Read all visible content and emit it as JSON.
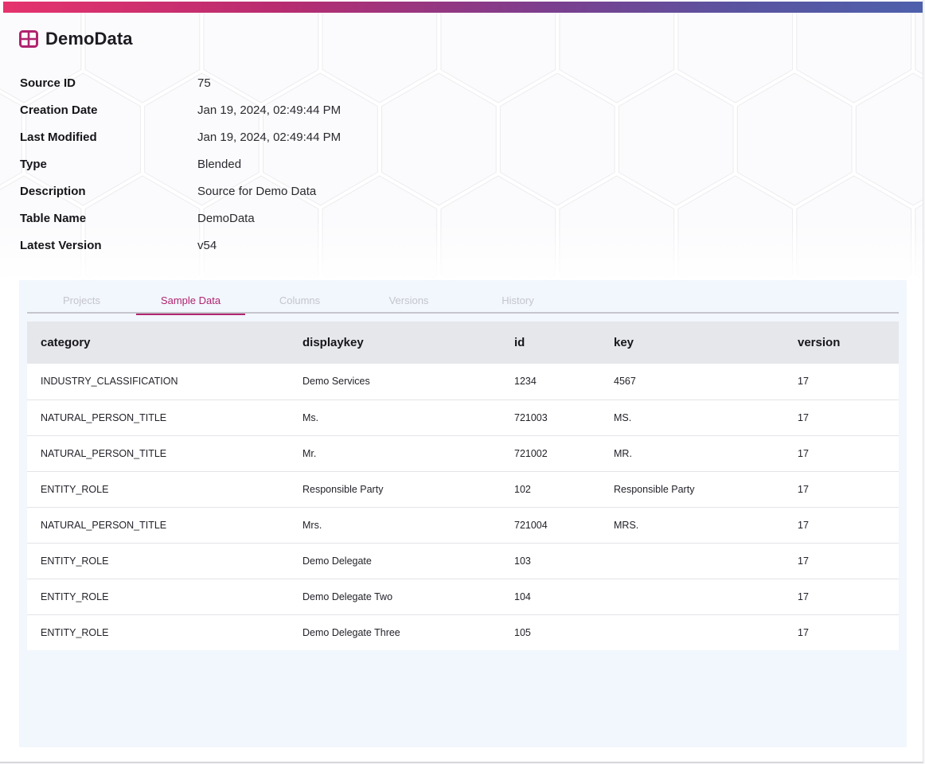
{
  "header": {
    "icon": "table-grid-icon",
    "title": "DemoData"
  },
  "colors": {
    "accent": "#b0246f",
    "gradient_start": "#e5336d",
    "gradient_end": "#4e60ac",
    "panel_bg": "#f2f6fd"
  },
  "metadata": [
    {
      "label": "Source ID",
      "value": "75"
    },
    {
      "label": "Creation Date",
      "value": "Jan 19, 2024, 02:49:44 PM"
    },
    {
      "label": "Last Modified",
      "value": "Jan 19, 2024, 02:49:44 PM"
    },
    {
      "label": "Type",
      "value": "Blended"
    },
    {
      "label": "Description",
      "value": "Source for Demo Data"
    },
    {
      "label": "Table Name",
      "value": "DemoData"
    },
    {
      "label": "Latest Version",
      "value": "v54"
    }
  ],
  "tabs": [
    {
      "label": "Projects",
      "active": false
    },
    {
      "label": "Sample Data",
      "active": true
    },
    {
      "label": "Columns",
      "active": false
    },
    {
      "label": "Versions",
      "active": false
    },
    {
      "label": "History",
      "active": false
    }
  ],
  "table": {
    "columns": [
      "category",
      "displaykey",
      "id",
      "key",
      "version"
    ],
    "rows": [
      [
        "INDUSTRY_CLASSIFICATION",
        "Demo Services",
        "1234",
        "4567",
        "17"
      ],
      [
        "NATURAL_PERSON_TITLE",
        "Ms.",
        "721003",
        "MS.",
        "17"
      ],
      [
        "NATURAL_PERSON_TITLE",
        "Mr.",
        "721002",
        "MR.",
        "17"
      ],
      [
        "ENTITY_ROLE",
        "Responsible Party",
        "102",
        "Responsible Party",
        "17"
      ],
      [
        "NATURAL_PERSON_TITLE",
        "Mrs.",
        "721004",
        "MRS.",
        "17"
      ],
      [
        "ENTITY_ROLE",
        "Demo Delegate",
        "103",
        "",
        "17"
      ],
      [
        "ENTITY_ROLE",
        "Demo Delegate Two",
        "104",
        "",
        "17"
      ],
      [
        "ENTITY_ROLE",
        "Demo Delegate Three",
        "105",
        "",
        "17"
      ]
    ]
  }
}
